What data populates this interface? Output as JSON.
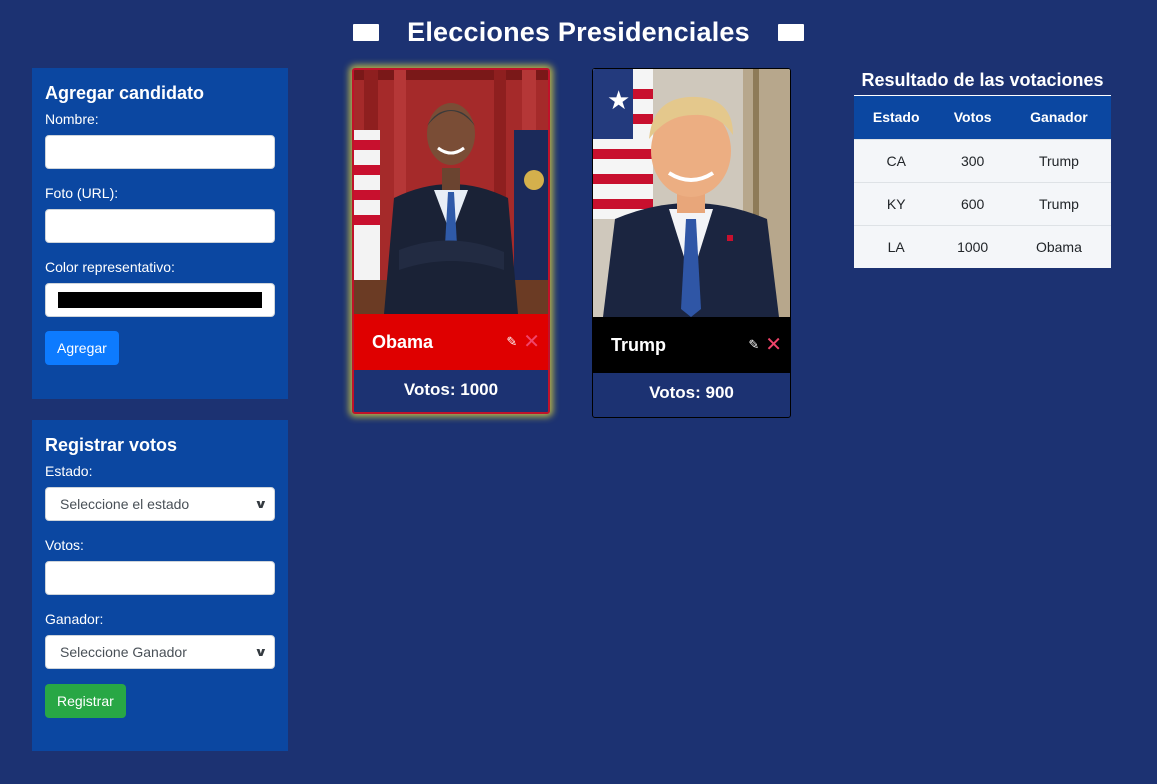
{
  "header": {
    "title": "Elecciones Presidenciales"
  },
  "add_panel": {
    "title": "Agregar candidato",
    "name_label": "Nombre:",
    "name_value": "",
    "photo_label": "Foto (URL):",
    "photo_value": "",
    "color_label": "Color representativo:",
    "color_value": "#000000",
    "submit_label": "Agregar"
  },
  "votes_panel": {
    "title": "Registrar votos",
    "state_label": "Estado:",
    "state_selected": "Seleccione el estado",
    "votes_label": "Votos:",
    "votes_value": "",
    "winner_label": "Ganador:",
    "winner_selected": "Seleccione Ganador",
    "submit_label": "Registrar"
  },
  "candidates": [
    {
      "name": "Obama",
      "votes_text": "Votos: 1000",
      "color": "#df0000",
      "leading": true
    },
    {
      "name": "Trump",
      "votes_text": "Votos: 900",
      "color": "#000000",
      "leading": false
    }
  ],
  "results": {
    "title": "Resultado de las votaciones",
    "columns": [
      "Estado",
      "Votos",
      "Ganador"
    ],
    "rows": [
      [
        "CA",
        "300",
        "Trump"
      ],
      [
        "KY",
        "600",
        "Trump"
      ],
      [
        "LA",
        "1000",
        "Obama"
      ]
    ]
  },
  "colors": {
    "background": "#1c3272",
    "panel": "#0b47a1",
    "primary_button": "#0d7bff",
    "success_button": "#28a745",
    "highlight_glow": "#e6dc3c"
  }
}
